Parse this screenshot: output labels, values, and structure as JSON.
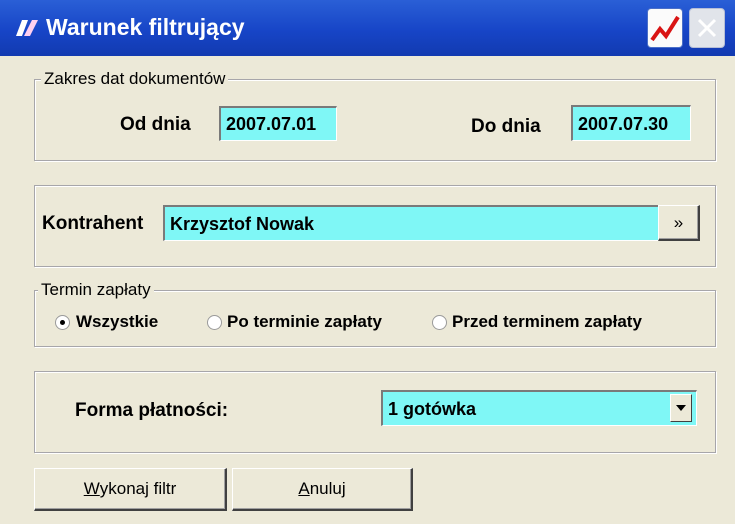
{
  "window": {
    "title": "Warunek filtrujący"
  },
  "dates": {
    "legend": "Zakres dat dokumentów",
    "from_label": "Od dnia",
    "from_value": "2007.07.01",
    "to_label": "Do dnia",
    "to_value": "2007.07.30"
  },
  "contractor": {
    "label": "Kontrahent",
    "value": "Krzysztof Nowak",
    "browse_label": "»"
  },
  "payment_term": {
    "legend": "Termin zapłaty",
    "options": [
      {
        "label": "Wszystkie",
        "selected": true
      },
      {
        "label": "Po terminie zapłaty",
        "selected": false
      },
      {
        "label": "Przed terminem zapłaty",
        "selected": false
      }
    ]
  },
  "payment_form": {
    "label": "Forma płatności:",
    "value": "1 gotówka"
  },
  "buttons": {
    "execute": {
      "accel": "W",
      "rest": "ykonaj filtr"
    },
    "cancel": {
      "accel": "A",
      "rest": "nuluj"
    }
  },
  "colors": {
    "field_bg": "#7ff7f6",
    "title_bar": "#1745c7"
  }
}
